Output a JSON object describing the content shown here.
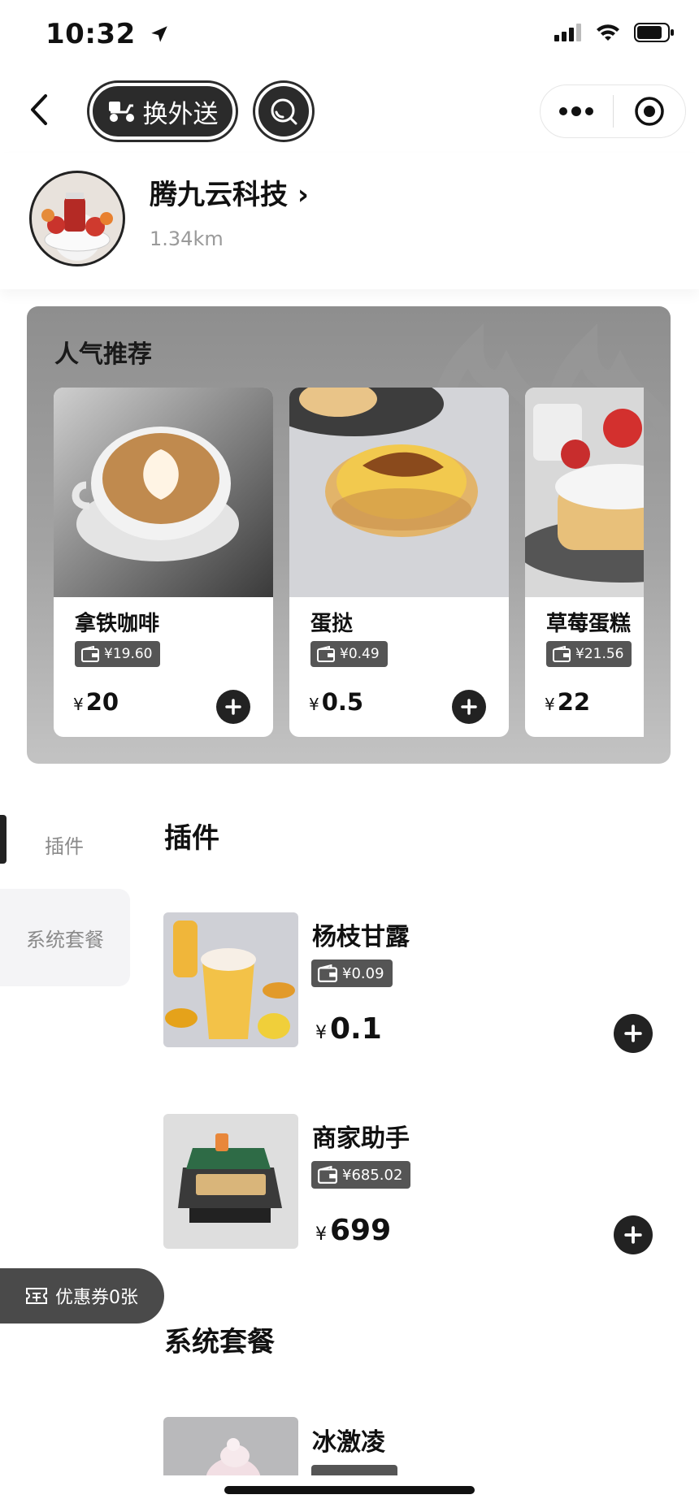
{
  "status_bar": {
    "time": "10:32"
  },
  "nav": {
    "delivery_label": "换外送"
  },
  "shop": {
    "name": "腾九云科技 ›",
    "distance": "1.34km"
  },
  "popular": {
    "title": "人气推荐",
    "items": [
      {
        "name": "拿铁咖啡",
        "tag_price": "¥19.60",
        "price": "20"
      },
      {
        "name": "蛋挞",
        "tag_price": "¥0.49",
        "price": "0.5"
      },
      {
        "name": "草莓蛋糕",
        "tag_price": "¥21.56",
        "price": "22"
      }
    ]
  },
  "sidebar": {
    "items": [
      {
        "label": "插件"
      },
      {
        "label": "系统套餐"
      }
    ]
  },
  "sections": [
    {
      "title": "插件",
      "items": [
        {
          "name": "杨枝甘露",
          "tag_price": "¥0.09",
          "price": "0.1"
        },
        {
          "name": "商家助手",
          "tag_price": "¥685.02",
          "price": "699"
        }
      ]
    },
    {
      "title": "系统套餐",
      "items": [
        {
          "name": "冰激凌"
        }
      ]
    }
  ],
  "currency": "¥",
  "coupon": {
    "label": "优惠券0张"
  },
  "icons": {
    "location": "location-arrow-icon",
    "signal": "cellular-signal-icon",
    "wifi": "wifi-icon",
    "battery": "battery-icon",
    "back": "chevron-left-icon",
    "scooter": "scooter-icon",
    "search": "search-icon",
    "more": "more-dots-icon",
    "close": "target-circle-icon",
    "wallet": "wallet-icon",
    "plus": "plus-icon",
    "ticket": "ticket-icon"
  },
  "colors": {
    "dark": "#222222",
    "tag": "#555555",
    "muted": "#8a8a8a"
  }
}
